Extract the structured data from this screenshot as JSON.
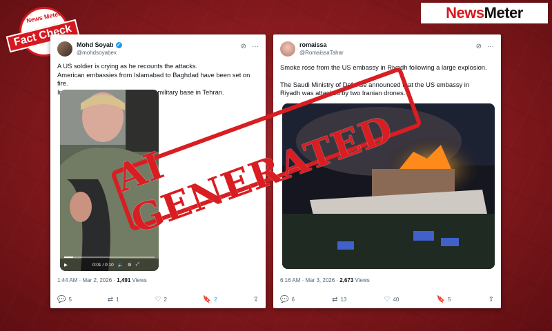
{
  "brand": {
    "logo_text_a": "News",
    "logo_text_b": "Meter",
    "badge_top": "News Meter",
    "badge_ribbon": "Fact Check"
  },
  "stamp": {
    "text": "AI GENERATED",
    "color": "#d81e22"
  },
  "posts": [
    {
      "name": "Mohd Soyab",
      "handle": "@mohdsoyabex",
      "verified": true,
      "lines": [
        "A US soldier is crying as he recounts the attacks.",
        "American embassies from Islamabad to Baghdad have been set on fire.",
        "Iran continues its attack on the US military base in Tehran."
      ],
      "video": {
        "time": "0:01 / 0:10",
        "progress": 0.1
      },
      "time": "1:44 AM · Mar 2, 2026 · ",
      "views_num": "1,491",
      "views_label": " Views",
      "replies": "5",
      "reposts": "1",
      "likes": "2",
      "bookmarks": "2"
    },
    {
      "name": "romaissa",
      "handle": "@RomaissaTahar",
      "verified": false,
      "lines": [
        "Smoke rose from the US embassy in Riyadh following a large explosion.",
        "",
        "The Saudi Ministry of Defense announced that the US embassy in",
        "Riyadh was attacked by two Iranian drones."
      ],
      "time": "6:16 AM · Mar 3, 2026 · ",
      "views_num": "2,673",
      "views_label": " Views",
      "replies": "6",
      "reposts": "13",
      "likes": "40",
      "bookmarks": "5"
    }
  ],
  "icons": [
    "grok-icon",
    "more-icon",
    "reply-icon",
    "repost-icon",
    "like-icon",
    "bookmark-icon",
    "share-icon",
    "play-icon",
    "volume-icon",
    "settings-icon",
    "fullscreen-icon"
  ]
}
